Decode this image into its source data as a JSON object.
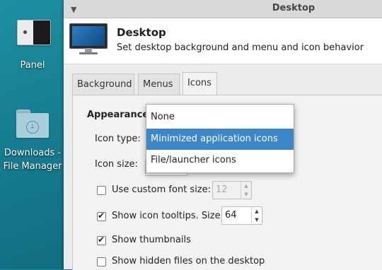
{
  "desktop": {
    "icons": [
      {
        "label": "Panel"
      },
      {
        "label_line1": "Downloads -",
        "label_line2": "File Manager"
      }
    ]
  },
  "window": {
    "title": "Desktop",
    "header": {
      "title": "Desktop",
      "subtitle": "Set desktop background and menu and icon behavior"
    },
    "tabs": [
      "Background",
      "Menus",
      "Icons"
    ],
    "active_tab": "Icons",
    "icons_tab": {
      "section": "Appearance",
      "icon_type_label": "Icon type:",
      "icon_size_label": "Icon size:",
      "custom_font_label": "Use custom font size:",
      "custom_font_value": "12",
      "tooltips_label": "Show icon tooltips. Size:",
      "tooltips_value": "64",
      "thumbnails_label": "Show thumbnails",
      "hidden_files_label": "Show hidden files on the desktop"
    },
    "dropdown": {
      "options": [
        "None",
        "Minimized application icons",
        "File/launcher icons"
      ],
      "selected": "Minimized application icons"
    }
  },
  "colors": {
    "desktop_bg": "#15788b",
    "selection": "#3d87c9"
  }
}
